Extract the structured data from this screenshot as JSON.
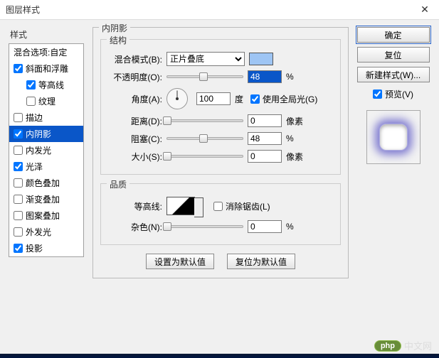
{
  "window": {
    "title": "图层样式"
  },
  "left": {
    "header": "样式",
    "items": [
      {
        "label": "混合选项:自定",
        "checkbox": false,
        "indent": 0
      },
      {
        "label": "斜面和浮雕",
        "checkbox": true,
        "checked": true,
        "indent": 0
      },
      {
        "label": "等高线",
        "checkbox": true,
        "checked": true,
        "indent": 1
      },
      {
        "label": "纹理",
        "checkbox": true,
        "checked": false,
        "indent": 1
      },
      {
        "label": "描边",
        "checkbox": true,
        "checked": false,
        "indent": 0
      },
      {
        "label": "内阴影",
        "checkbox": true,
        "checked": true,
        "indent": 0,
        "selected": true
      },
      {
        "label": "内发光",
        "checkbox": true,
        "checked": false,
        "indent": 0
      },
      {
        "label": "光泽",
        "checkbox": true,
        "checked": true,
        "indent": 0
      },
      {
        "label": "颜色叠加",
        "checkbox": true,
        "checked": false,
        "indent": 0
      },
      {
        "label": "渐变叠加",
        "checkbox": true,
        "checked": false,
        "indent": 0
      },
      {
        "label": "图案叠加",
        "checkbox": true,
        "checked": false,
        "indent": 0
      },
      {
        "label": "外发光",
        "checkbox": true,
        "checked": false,
        "indent": 0
      },
      {
        "label": "投影",
        "checkbox": true,
        "checked": true,
        "indent": 0
      }
    ]
  },
  "main": {
    "title": "内阴影",
    "structure": {
      "legend": "结构",
      "blend_label": "混合模式(B):",
      "blend_value": "正片叠底",
      "color": "#9ec5f4",
      "opacity_label": "不透明度(O):",
      "opacity_value": "48",
      "opacity_unit": "%",
      "angle_label": "角度(A):",
      "angle_value": "100",
      "angle_unit": "度",
      "global_light_label": "使用全局光(G)",
      "global_light_checked": true,
      "distance_label": "距离(D):",
      "distance_value": "0",
      "distance_unit": "像素",
      "choke_label": "阻塞(C):",
      "choke_value": "48",
      "choke_unit": "%",
      "size_label": "大小(S):",
      "size_value": "0",
      "size_unit": "像素"
    },
    "quality": {
      "legend": "品质",
      "contour_label": "等高线:",
      "antialias_label": "消除锯齿(L)",
      "antialias_checked": false,
      "noise_label": "杂色(N):",
      "noise_value": "0",
      "noise_unit": "%"
    },
    "buttons": {
      "set_default": "设置为默认值",
      "reset_default": "复位为默认值"
    }
  },
  "right": {
    "ok": "确定",
    "reset": "复位",
    "new_style": "新建样式(W)...",
    "preview_label": "预览(V)",
    "preview_checked": true
  },
  "watermark": {
    "pill": "php",
    "text": "中文网"
  }
}
